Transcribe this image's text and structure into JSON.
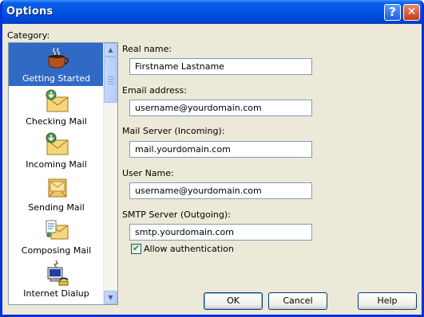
{
  "window": {
    "title": "Options"
  },
  "titlebar": {
    "help_glyph": "?",
    "close_glyph": "✕"
  },
  "category": {
    "label": "Category:",
    "items": [
      {
        "label": "Getting Started",
        "icon": "coffee-cup-icon",
        "selected": true
      },
      {
        "label": "Checking Mail",
        "icon": "mail-check-icon",
        "selected": false
      },
      {
        "label": "Incoming Mail",
        "icon": "mail-incoming-icon",
        "selected": false
      },
      {
        "label": "Sending Mail",
        "icon": "mail-sending-icon",
        "selected": false
      },
      {
        "label": "Composing Mail",
        "icon": "mail-compose-icon",
        "selected": false
      },
      {
        "label": "Internet Dialup",
        "icon": "computer-phone-icon",
        "selected": false
      }
    ]
  },
  "form": {
    "real_name_label": "Real name:",
    "real_name_value": "Firstname Lastname",
    "email_label": "Email address:",
    "email_value": "username@yourdomain.com",
    "incoming_label": "Mail Server (Incoming):",
    "incoming_value": "mail.yourdomain.com",
    "username_label": "User Name:",
    "username_value": "username@yourdomain.com",
    "smtp_label": "SMTP Server (Outgoing):",
    "smtp_value": "smtp.yourdomain.com",
    "allow_auth_label": "Allow authentication",
    "allow_auth_checked": true,
    "checkmark": "✔"
  },
  "buttons": {
    "ok": "OK",
    "cancel": "Cancel",
    "help": "Help"
  },
  "colors": {
    "titlebar": "#0055e5",
    "selection": "#316ac5",
    "dialog_bg": "#ece9d8"
  }
}
